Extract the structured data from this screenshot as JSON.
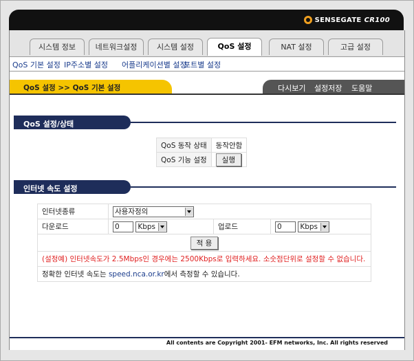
{
  "brand": {
    "name": "SENSEGATE",
    "model": "CR100"
  },
  "tabs": [
    {
      "label": "시스템 정보",
      "active": false
    },
    {
      "label": "네트워크설정",
      "active": false
    },
    {
      "label": "시스템 설정",
      "active": false
    },
    {
      "label": "QoS 설정",
      "active": true
    },
    {
      "label": "NAT 설정",
      "active": false
    },
    {
      "label": "고급 설정",
      "active": false
    }
  ],
  "subnav": [
    "QoS 기본 설정",
    "IP주소별 설정",
    "어플리케이션별 설정",
    "포트별 설정"
  ],
  "breadcrumb": "QoS 설정 >> QoS 기본 설정",
  "actions": [
    "다시보기",
    "설정저장",
    "도움말"
  ],
  "qos_section": {
    "title": "QoS 설정/상태",
    "rows": [
      {
        "label": "QoS 동작 상태",
        "value": "동작안함"
      },
      {
        "label": "QoS 기능 설정",
        "button": "실행"
      }
    ]
  },
  "speed_section": {
    "title": "인터넷 속도 설정",
    "type_label": "인터넷종류",
    "type_value": "사용자정의",
    "download_label": "다운로드",
    "download_value": "0",
    "download_unit": "Kbps",
    "upload_label": "업로드",
    "upload_value": "0",
    "upload_unit": "Kbps",
    "apply_button": "적 용",
    "note": "(설정예) 인터넷속도가 2.5Mbps인 경우에는 2500Kbps로 입력하세요. 소숫점단위로 설정할 수 없습니다.",
    "info_prefix": "정확한 인터넷 속도는 ",
    "info_link": "speed.nca.or.kr",
    "info_suffix": "에서 측정할 수 있습니다."
  },
  "footer": "All contents are Copyright   2001- EFM networks, Inc. All rights reserved"
}
